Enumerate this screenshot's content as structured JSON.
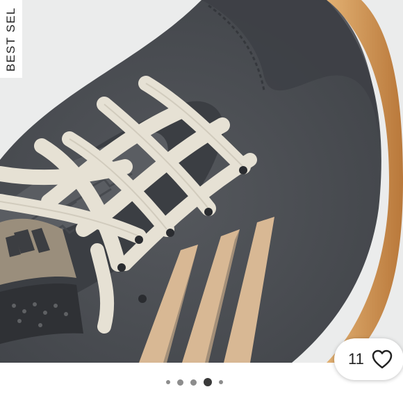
{
  "gallery": {
    "badge_label": "BEST SEL",
    "image_icon": "sneaker-photo",
    "likes": {
      "count": "11",
      "icon": "heart-outline-icon"
    },
    "pagination": {
      "total": 5,
      "active_index": 3
    }
  },
  "colors": {
    "suede": "#4a4d52",
    "laces": "#e6e1d4",
    "stripes": "#d8b894",
    "gum_sole": "#c98e4f"
  }
}
